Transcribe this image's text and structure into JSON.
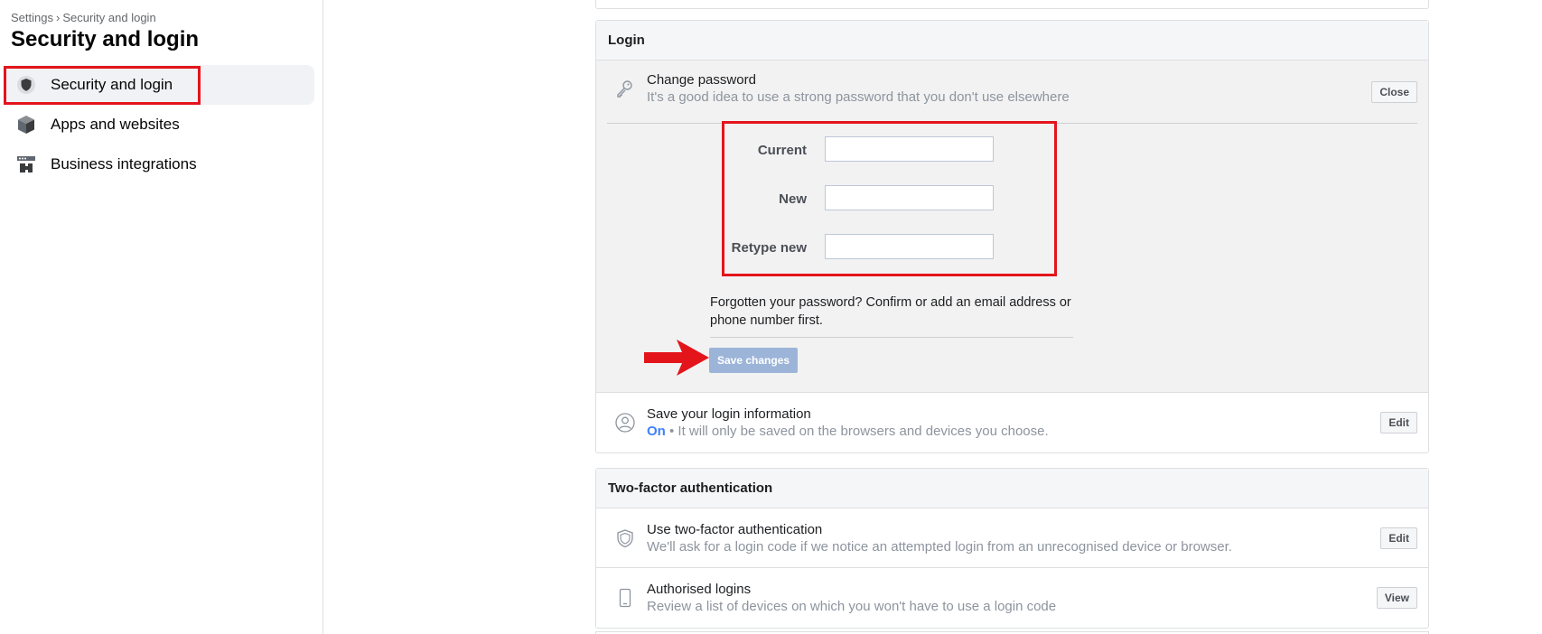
{
  "breadcrumb": {
    "root": "Settings",
    "separator": "›",
    "current": "Security and login"
  },
  "sidebar": {
    "title": "Security and login",
    "items": [
      {
        "label": "Security and login",
        "icon": "shield-icon",
        "active": true
      },
      {
        "label": "Apps and websites",
        "icon": "cube-icon",
        "active": false
      },
      {
        "label": "Business integrations",
        "icon": "business-integrations-icon",
        "active": false
      }
    ]
  },
  "login": {
    "header": "Login",
    "change_password": {
      "title": "Change password",
      "subtitle": "It's a good idea to use a strong password that you don't use elsewhere",
      "close_label": "Close",
      "fields": [
        {
          "label": "Current",
          "value": ""
        },
        {
          "label": "New",
          "value": ""
        },
        {
          "label": "Retype new",
          "value": ""
        }
      ],
      "forgot_text": "Forgotten your password? Confirm or add an email address or phone number first.",
      "save_label": "Save changes"
    },
    "save_login": {
      "title": "Save your login information",
      "status": "On",
      "description": " • It will only be saved on the browsers and devices you choose.",
      "edit_label": "Edit"
    }
  },
  "two_factor": {
    "header": "Two-factor authentication",
    "rows": [
      {
        "title": "Use two-factor authentication",
        "subtitle": "We'll ask for a login code if we notice an attempted login from an unrecognised device or browser.",
        "button": "Edit",
        "icon": "shield-outline-icon"
      },
      {
        "title": "Authorised logins",
        "subtitle": "Review a list of devices on which you won't have to use a login code",
        "button": "View",
        "icon": "phone-icon"
      }
    ]
  },
  "colors": {
    "highlight": "#e4141b",
    "status_on": "#4080ff",
    "save_button": "#9cb4d8"
  }
}
